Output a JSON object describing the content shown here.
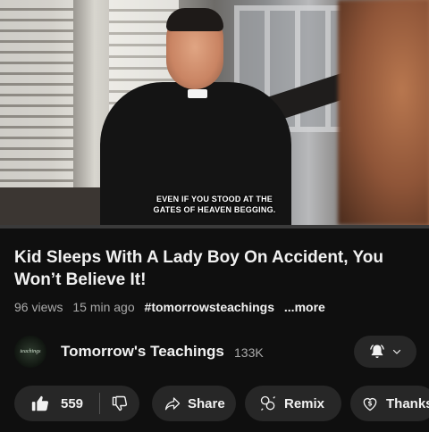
{
  "video": {
    "caption_line1": "EVEN IF YOU STOOD AT THE",
    "caption_line2": "GATES OF HEAVEN BEGGING.",
    "progress_fraction": 0.0
  },
  "title": "Kid Sleeps With A Lady Boy On Accident, You Won’t Believe It!",
  "meta": {
    "views": "96 views",
    "time": "15 min ago",
    "hashtag": "#tomorrowsteachings",
    "more": "...more"
  },
  "channel": {
    "avatar_text": "teachings",
    "name": "Tomorrow's Teachings",
    "subscribers": "133K",
    "bell_icon": "bell-ring-icon",
    "chevron_icon": "chevron-down-icon"
  },
  "actions": {
    "like_count": "559",
    "like_icon": "thumbs-up-icon",
    "dislike_icon": "thumbs-down-icon",
    "share_label": "Share",
    "remix_label": "Remix",
    "thanks_label": "Thanks"
  },
  "colors": {
    "background": "#0f0f0f",
    "pill": "#272727",
    "progress": "#ff0000",
    "secondary_text": "#aaaaaa"
  }
}
